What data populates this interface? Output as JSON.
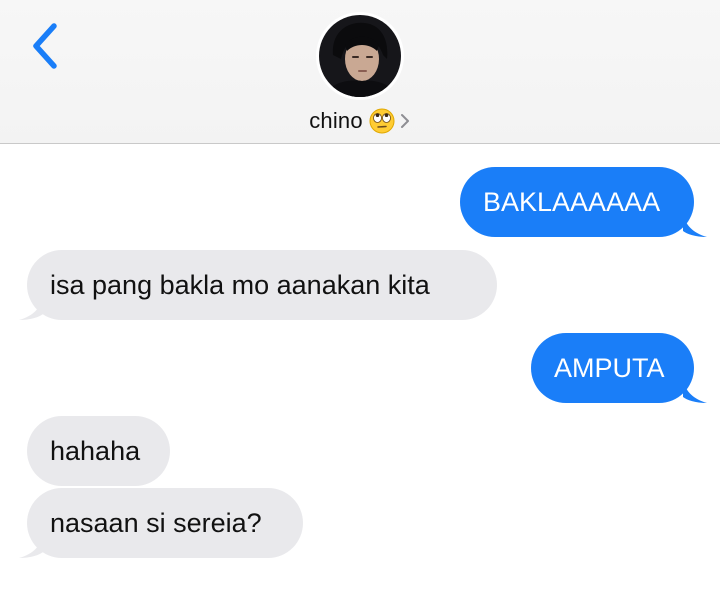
{
  "header": {
    "contact_name": "chino",
    "contact_emoji": "face-with-rolling-eyes-emoji",
    "back_icon": "chevron-left-icon",
    "details_icon": "chevron-right-icon",
    "avatar": "contact-avatar-photo"
  },
  "colors": {
    "accent": "#1a7ef8",
    "sent_bubble": "#1a7ef8",
    "received_bubble": "#e9e9ec",
    "header_bg": "#f5f5f5"
  },
  "messages": [
    {
      "direction": "sent",
      "text": "BAKLAAAAAA"
    },
    {
      "direction": "received",
      "text": "isa pang bakla mo aanakan kita"
    },
    {
      "direction": "sent",
      "text": "AMPUTA"
    },
    {
      "direction": "received",
      "text": "hahaha"
    },
    {
      "direction": "received",
      "text": "nasaan si sereia?"
    }
  ]
}
